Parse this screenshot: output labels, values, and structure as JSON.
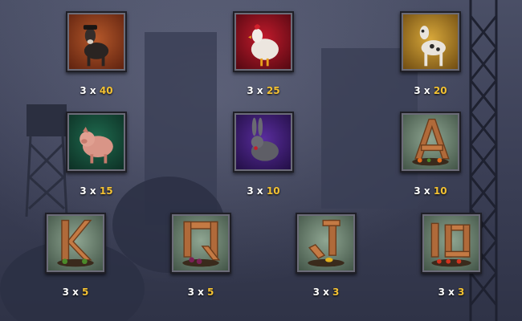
{
  "colors": {
    "payout_value": "#f4c233",
    "payout_prefix": "#ffffff"
  },
  "symbols": [
    {
      "icon": "goat-icon",
      "prefix": "3 x",
      "value": "40"
    },
    {
      "icon": "rooster-icon",
      "prefix": "3 x",
      "value": "25"
    },
    {
      "icon": "dog-icon",
      "prefix": "3 x",
      "value": "20"
    },
    {
      "icon": "pig-icon",
      "prefix": "3 x",
      "value": "15"
    },
    {
      "icon": "rabbit-icon",
      "prefix": "3 x",
      "value": "10"
    },
    {
      "icon": "wood-letter-a-icon",
      "prefix": "3 x",
      "value": "10"
    },
    {
      "icon": "wood-letter-k-icon",
      "prefix": "3 x",
      "value": "5"
    },
    {
      "icon": "wood-letter-q-icon",
      "prefix": "3 x",
      "value": "5"
    },
    {
      "icon": "wood-letter-j-icon",
      "prefix": "3 x",
      "value": "3"
    },
    {
      "icon": "wood-number-10-icon",
      "prefix": "3 x",
      "value": "3"
    }
  ]
}
